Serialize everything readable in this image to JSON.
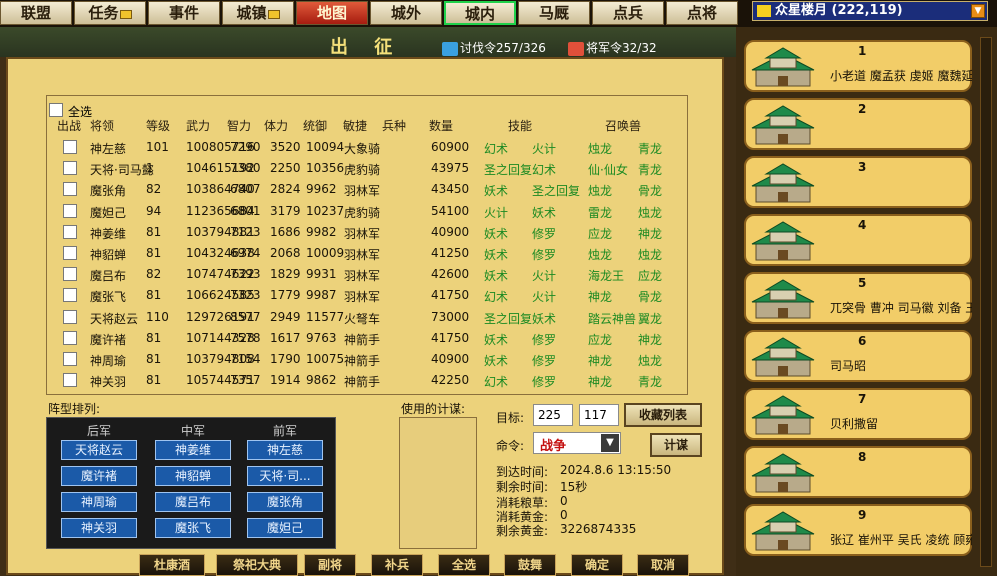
{
  "nav": {
    "tabs": [
      {
        "label": "联盟",
        "mail": false
      },
      {
        "label": "任务",
        "mail": true
      },
      {
        "label": "事件",
        "mail": false
      },
      {
        "label": "城镇",
        "mail": true
      },
      {
        "label": "地图",
        "mail": false
      },
      {
        "label": "城外",
        "mail": false
      },
      {
        "label": "城内",
        "mail": false
      },
      {
        "label": "马厩",
        "mail": false
      },
      {
        "label": "点兵",
        "mail": false
      },
      {
        "label": "点将",
        "mail": false
      }
    ],
    "active_tab": "地图",
    "selected_tab": "城内"
  },
  "server": {
    "label": "众星楼月 (222,119)"
  },
  "header": {
    "title": "出 征",
    "expedition_orders": "讨伐令257/326",
    "general_orders": "将军令32/32"
  },
  "table": {
    "select_all": "全选",
    "columns": [
      "出战",
      "将领",
      "等级",
      "武力",
      "智力",
      "体力",
      "统御",
      "敏捷",
      "兵种",
      "数量",
      "技能",
      "召唤兽"
    ],
    "rows": [
      {
        "name": "神左慈",
        "level": "101",
        "power": "100805716",
        "int": "7290",
        "hp": "3520",
        "lead": "10094",
        "troop": "大象骑",
        "count": "60900",
        "skill1": "幻术",
        "skill2": "火计",
        "beast1": "烛龙",
        "beast2": "青龙"
      },
      {
        "name": "天将·司马懿",
        "level": "1",
        "power": "104615192",
        "int": "7380",
        "hp": "2250",
        "lead": "10356",
        "troop": "虎豹骑",
        "count": "43975",
        "skill1": "圣之回复",
        "skill2": "幻术",
        "beast1": "仙·仙女",
        "beast2": "青龙"
      },
      {
        "name": "魔张角",
        "level": "82",
        "power": "103864740",
        "int": "6807",
        "hp": "2824",
        "lead": "9962",
        "troop": "羽林军",
        "count": "43450",
        "skill1": "妖术",
        "skill2": "圣之回复",
        "beast1": "烛龙",
        "beast2": "骨龙"
      },
      {
        "name": "魔妲己",
        "level": "94",
        "power": "112365684",
        "int": "6801",
        "hp": "3179",
        "lead": "10237",
        "troop": "虎豹骑",
        "count": "54100",
        "skill1": "火计",
        "skill2": "妖术",
        "beast1": "雷龙",
        "beast2": "烛龙"
      },
      {
        "name": "神姜维",
        "level": "81",
        "power": "103794881",
        "int": "7123",
        "hp": "1686",
        "lead": "9982",
        "troop": "羽林军",
        "count": "40900",
        "skill1": "妖术",
        "skill2": "修罗",
        "beast1": "应龙",
        "beast2": "神龙"
      },
      {
        "name": "神貂蝉",
        "level": "81",
        "power": "104324638",
        "int": "6974",
        "hp": "2068",
        "lead": "10009",
        "troop": "羽林军",
        "count": "41250",
        "skill1": "妖术",
        "skill2": "修罗",
        "beast1": "烛龙",
        "beast2": "烛龙"
      },
      {
        "name": "魔吕布",
        "level": "82",
        "power": "107474622",
        "int": "7393",
        "hp": "1829",
        "lead": "9931",
        "troop": "羽林军",
        "count": "42600",
        "skill1": "妖术",
        "skill2": "火计",
        "beast1": "海龙王",
        "beast2": "应龙"
      },
      {
        "name": "魔张飞",
        "level": "81",
        "power": "106624585",
        "int": "7323",
        "hp": "1779",
        "lead": "9987",
        "troop": "羽林军",
        "count": "41750",
        "skill1": "幻术",
        "skill2": "火计",
        "beast1": "神龙",
        "beast2": "骨龙"
      },
      {
        "name": "天将赵云",
        "level": "110",
        "power": "129726191",
        "int": "8577",
        "hp": "2949",
        "lead": "11577",
        "troop": "火弩车",
        "count": "73000",
        "skill1": "圣之回复",
        "skill2": "妖术",
        "beast1": "踏云神兽",
        "beast2": "翼龙"
      },
      {
        "name": "魔许褚",
        "level": "81",
        "power": "107144328",
        "int": "7578",
        "hp": "1617",
        "lead": "9763",
        "troop": "神箭手",
        "count": "41750",
        "skill1": "妖术",
        "skill2": "修罗",
        "beast1": "应龙",
        "beast2": "神龙"
      },
      {
        "name": "神周瑜",
        "level": "81",
        "power": "103794808",
        "int": "7154",
        "hp": "1790",
        "lead": "10075",
        "troop": "神箭手",
        "count": "40900",
        "skill1": "妖术",
        "skill2": "修罗",
        "beast1": "神龙",
        "beast2": "烛龙"
      },
      {
        "name": "神关羽",
        "level": "81",
        "power": "105744571",
        "int": "7357",
        "hp": "1914",
        "lead": "9862",
        "troop": "神箭手",
        "count": "42250",
        "skill1": "幻术",
        "skill2": "修罗",
        "beast1": "神龙",
        "beast2": "青龙"
      }
    ]
  },
  "formation": {
    "label": "阵型排列:",
    "heads": [
      "后军",
      "中军",
      "前军"
    ],
    "grid": [
      [
        "天将赵云",
        "神姜维",
        "神左慈"
      ],
      [
        "魔许褚",
        "神貂蝉",
        "天将·司..."
      ],
      [
        "神周瑜",
        "魔吕布",
        "魔张角"
      ],
      [
        "神关羽",
        "魔张飞",
        "魔妲己"
      ]
    ]
  },
  "plan": {
    "label": "使用的计谋:"
  },
  "target": {
    "label": "目标:",
    "x": "225",
    "y": "117",
    "collect_btn": "收藏列表",
    "command_label": "命令:",
    "command_value": "战争",
    "plan_btn": "计谋",
    "arrive_label": "到达时间:",
    "arrive_value": "2024.8.6  13:15:50",
    "remain_label": "剩余时间:",
    "remain_value": "15秒",
    "food_label": "消耗粮草:",
    "food_value": "0",
    "gold_label": "消耗黄金:",
    "gold_value": "0",
    "left_gold_label": "剩余黄金:",
    "left_gold_value": "3226874335"
  },
  "bottom": {
    "buttons": [
      "杜康酒",
      "祭祀大典",
      "副将",
      "补兵",
      "全选",
      "鼓舞",
      "确定",
      "取消"
    ]
  },
  "cities": [
    {
      "num": "1",
      "text": "小老道 魔孟获 虔姬 魔魏延"
    },
    {
      "num": "2",
      "text": ""
    },
    {
      "num": "3",
      "text": ""
    },
    {
      "num": "4",
      "text": ""
    },
    {
      "num": "5",
      "text": "兀突骨 曹冲 司马徽 刘备 王"
    },
    {
      "num": "6",
      "text": "司马昭"
    },
    {
      "num": "7",
      "text": "贝利撒留"
    },
    {
      "num": "8",
      "text": ""
    },
    {
      "num": "9",
      "text": "张辽 崔州平 吴氏 凌统 顾雍"
    }
  ]
}
